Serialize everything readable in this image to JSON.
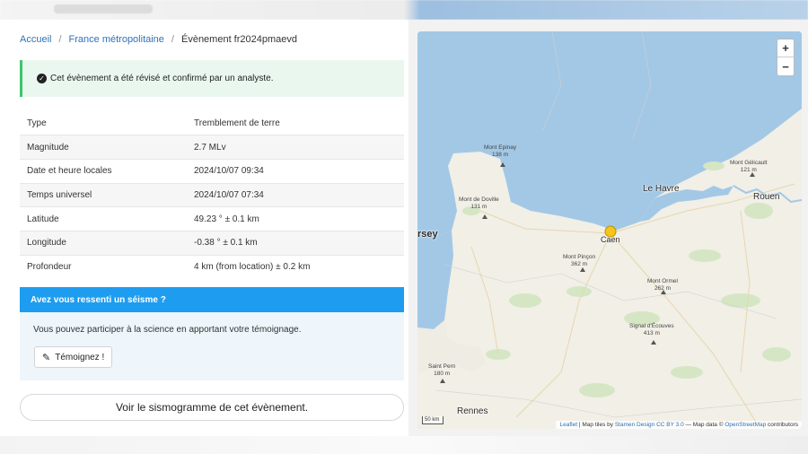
{
  "breadcrumb": {
    "home": "Accueil",
    "region": "France métropolitaine",
    "current": "Évènement fr2024pmaevd"
  },
  "alert": {
    "text": "Cet évènement a été révisé et confirmé par un analyste."
  },
  "details": [
    {
      "label": "Type",
      "value": "Tremblement de terre"
    },
    {
      "label": "Magnitude",
      "value": "2.7 MLv"
    },
    {
      "label": "Date et heure locales",
      "value": "2024/10/07 09:34"
    },
    {
      "label": "Temps universel",
      "value": "2024/10/07 07:34"
    },
    {
      "label": "Latitude",
      "value": "49.23 ° ± 0.1 km"
    },
    {
      "label": "Longitude",
      "value": "-0.38 ° ± 0.1 km"
    },
    {
      "label": "Profondeur",
      "value": "4 km (from location) ± 0.2 km"
    }
  ],
  "testimony": {
    "title": "Avez vous ressenti un séisme ?",
    "text": "Vous pouvez participer à la science en apportant votre témoignage.",
    "button": "Témoignez !"
  },
  "seismogram_button": "Voir le sismogramme de cet évènement.",
  "map": {
    "zoom_in": "+",
    "zoom_out": "−",
    "scale": "50 km",
    "attribution": {
      "leaflet": "Leaflet",
      "tiles_prefix": "| Map tiles by",
      "stamen": "Stamen Design",
      "cc": "CC BY 3.0",
      "data_prefix": "— Map data ©",
      "osm": "OpenStreetMap",
      "suffix": "contributors"
    },
    "cities": {
      "le_havre": "Le Havre",
      "rouen": "Rouen",
      "caen": "Caen",
      "rennes": "Rennes",
      "jersey": "rsey"
    },
    "mountains": {
      "m1": {
        "name": "Mont Epinay",
        "alt": "138 m"
      },
      "m2": {
        "name": "Mont de Doville",
        "alt": "131 m"
      },
      "m3": {
        "name": "Mont Gélicault",
        "alt": "121 m"
      },
      "m4": {
        "name": "Mont Pinçon",
        "alt": "362 m"
      },
      "m5": {
        "name": "Mont Ormel",
        "alt": "262 m"
      },
      "m6": {
        "name": "Signal d'Écouves",
        "alt": "413 m"
      },
      "m7": {
        "name": "Saint Pern",
        "alt": "180 m"
      }
    },
    "colors": {
      "sea": "#a3c8e6",
      "land": "#f1efe6",
      "epicenter": "#f5c518"
    }
  }
}
